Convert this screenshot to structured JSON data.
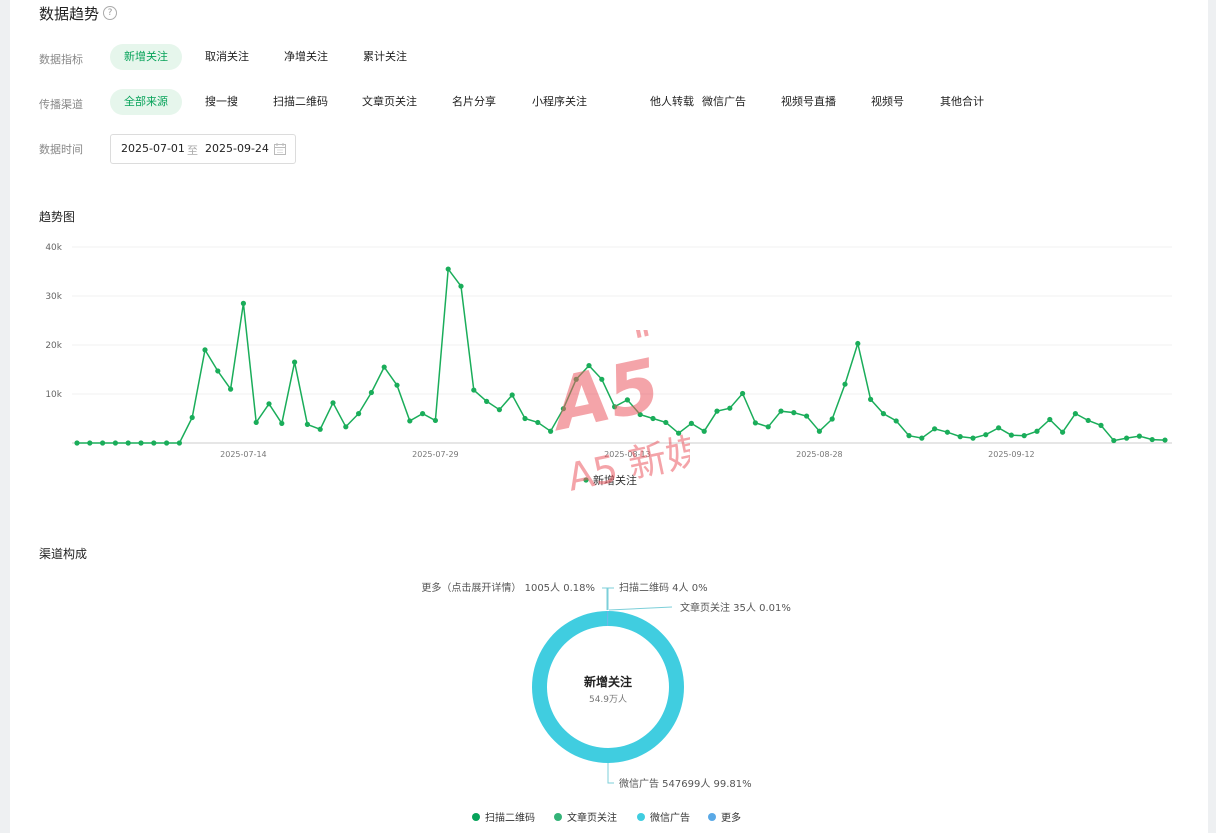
{
  "page": {
    "title": "数据趋势",
    "help_icon": "question-circle-icon"
  },
  "filters": {
    "metric": {
      "label": "数据指标",
      "options": [
        "新增关注",
        "取消关注",
        "净增关注",
        "累计关注"
      ],
      "selected": "新增关注"
    },
    "channel": {
      "label": "传播渠道",
      "options": [
        "全部来源",
        "搜一搜",
        "扫描二维码",
        "文章页关注",
        "名片分享",
        "小程序关注",
        "他人转载",
        "微信广告",
        "视频号直播",
        "视频号",
        "其他合计"
      ],
      "selected": "全部来源"
    },
    "date": {
      "label": "数据时间",
      "start": "2025-07-01",
      "separator": "至",
      "end": "2025-09-24",
      "icon": "calendar-icon"
    }
  },
  "trend": {
    "title": "趋势图",
    "watermark": "A5 新媒体"
  },
  "composition": {
    "title": "渠道构成"
  },
  "colors": {
    "accent": "#07c160",
    "accent_bg": "#e6f6ec",
    "line": "#1aad5a",
    "donut_main": "#40cde0",
    "legend_qr": "#07a35a",
    "legend_article": "#34b378",
    "legend_ad": "#40cde0",
    "legend_more": "#5aa9e6"
  },
  "chart_data": [
    {
      "type": "line",
      "title": "",
      "xlabel": "",
      "ylabel": "",
      "ylim": [
        0,
        40000
      ],
      "y_ticks": [
        "40k",
        "30k",
        "20k",
        "10k"
      ],
      "x_tick_labels": [
        "2025-07-14",
        "2025-07-29",
        "2025-08-13",
        "2025-08-28",
        "2025-09-12"
      ],
      "grid": true,
      "legend_position": "bottom",
      "x": [
        "2025-07-01",
        "2025-07-02",
        "2025-07-03",
        "2025-07-04",
        "2025-07-05",
        "2025-07-06",
        "2025-07-07",
        "2025-07-08",
        "2025-07-09",
        "2025-07-10",
        "2025-07-11",
        "2025-07-12",
        "2025-07-13",
        "2025-07-14",
        "2025-07-15",
        "2025-07-16",
        "2025-07-17",
        "2025-07-18",
        "2025-07-19",
        "2025-07-20",
        "2025-07-21",
        "2025-07-22",
        "2025-07-23",
        "2025-07-24",
        "2025-07-25",
        "2025-07-26",
        "2025-07-27",
        "2025-07-28",
        "2025-07-29",
        "2025-07-30",
        "2025-07-31",
        "2025-08-01",
        "2025-08-02",
        "2025-08-03",
        "2025-08-04",
        "2025-08-05",
        "2025-08-06",
        "2025-08-07",
        "2025-08-08",
        "2025-08-09",
        "2025-08-10",
        "2025-08-11",
        "2025-08-12",
        "2025-08-13",
        "2025-08-14",
        "2025-08-15",
        "2025-08-16",
        "2025-08-17",
        "2025-08-18",
        "2025-08-19",
        "2025-08-20",
        "2025-08-21",
        "2025-08-22",
        "2025-08-23",
        "2025-08-24",
        "2025-08-25",
        "2025-08-26",
        "2025-08-27",
        "2025-08-28",
        "2025-08-29",
        "2025-08-30",
        "2025-08-31",
        "2025-09-01",
        "2025-09-02",
        "2025-09-03",
        "2025-09-04",
        "2025-09-05",
        "2025-09-06",
        "2025-09-07",
        "2025-09-08",
        "2025-09-09",
        "2025-09-10",
        "2025-09-11",
        "2025-09-12",
        "2025-09-13",
        "2025-09-14",
        "2025-09-15",
        "2025-09-16",
        "2025-09-17",
        "2025-09-18",
        "2025-09-19",
        "2025-09-20",
        "2025-09-21",
        "2025-09-22",
        "2025-09-23",
        "2025-09-24"
      ],
      "series": [
        {
          "name": "新增关注",
          "values": [
            0,
            0,
            0,
            0,
            0,
            0,
            0,
            0,
            0,
            5200,
            19000,
            14700,
            11000,
            28500,
            4200,
            8000,
            4000,
            16500,
            3800,
            2800,
            8200,
            3300,
            6000,
            10300,
            15500,
            11800,
            4500,
            6000,
            4600,
            35500,
            32000,
            10800,
            8500,
            6800,
            9800,
            5000,
            4200,
            2400,
            7000,
            13000,
            15800,
            13000,
            7400,
            8800,
            5800,
            5000,
            4200,
            2000,
            4000,
            2400,
            6500,
            7100,
            10100,
            4100,
            3300,
            6500,
            6200,
            5500,
            2400,
            4900,
            12000,
            20300,
            8900,
            6000,
            4500,
            1500,
            1000,
            2900,
            2200,
            1300,
            1000,
            1700,
            3100,
            1600,
            1500,
            2400,
            4800,
            2200,
            6000,
            4600,
            3600,
            500,
            1000,
            1400,
            700,
            600
          ]
        }
      ]
    },
    {
      "type": "pie",
      "title": "",
      "center_title": "新增关注",
      "center_value": "54.9万人",
      "slices": [
        {
          "name": "扫描二维码",
          "value": 4,
          "percent": "0%",
          "label": "扫描二维码 4人 0%"
        },
        {
          "name": "文章页关注",
          "value": 35,
          "percent": "0.01%",
          "label": "文章页关注 35人 0.01%"
        },
        {
          "name": "微信广告",
          "value": 547699,
          "percent": "99.81%",
          "label": "微信广告 547699人 99.81%"
        },
        {
          "name": "更多",
          "value": 1005,
          "percent": "0.18%",
          "label": "更多（点击展开详情） 1005人 0.18%"
        }
      ],
      "legend": [
        "扫描二维码",
        "文章页关注",
        "微信广告",
        "更多"
      ],
      "legend_position": "bottom"
    }
  ]
}
